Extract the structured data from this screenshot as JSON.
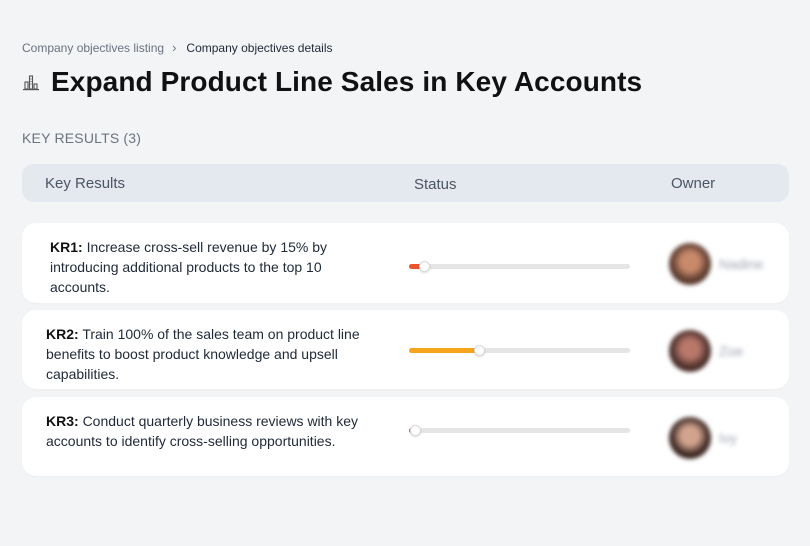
{
  "breadcrumb": {
    "parent": "Company objectives listing",
    "separator": "›",
    "current": "Company objectives details"
  },
  "page": {
    "title": "Expand Product Line Sales in Key Accounts",
    "title_icon": "building-chart-icon"
  },
  "key_results_section": {
    "label": "KEY RESULTS",
    "count": "(3)"
  },
  "table": {
    "columns": [
      "Key Results",
      "Status",
      "Owner"
    ],
    "rows": [
      {
        "code": "KR1:",
        "text": "Increase cross-sell revenue by 15% by introducing additional products to the top 10 accounts.",
        "progress": 0.07,
        "progress_color": "#f0522d",
        "owner_name": "Nadine",
        "avatar_colors": [
          "#5a3a2e",
          "#c98a6b"
        ]
      },
      {
        "code": "KR2:",
        "text": "Train 100% of the sales team on product line benefits to boost product knowledge and upsell capabilities.",
        "progress": 0.32,
        "progress_color": "#f7a41d",
        "owner_name": "Zoe",
        "avatar_colors": [
          "#4a2e2a",
          "#b8786a"
        ]
      },
      {
        "code": "KR3:",
        "text": "Conduct quarterly business reviews with key accounts to identify cross-selling opportunities.",
        "progress": 0.02,
        "progress_color": "#f0522d",
        "owner_name": "Ivy",
        "avatar_colors": [
          "#3b2622",
          "#d2a48e"
        ]
      }
    ]
  }
}
